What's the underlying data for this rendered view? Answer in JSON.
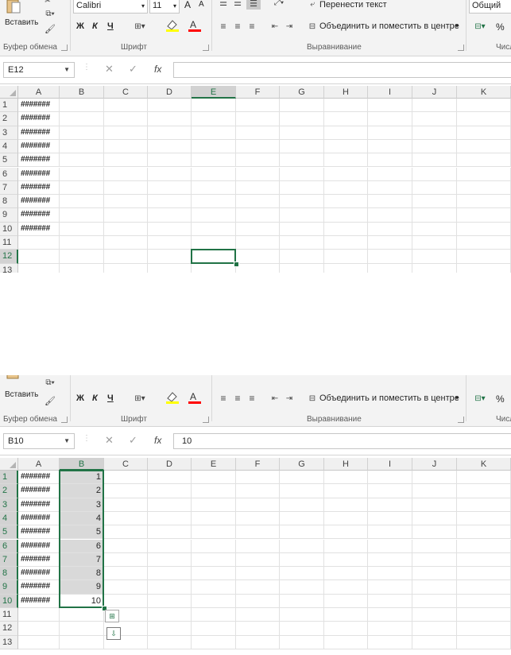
{
  "ribbon": {
    "font_name": "Calibri",
    "font_size": "11",
    "grow_font": "A",
    "shrink_font": "A",
    "bold": "Ж",
    "italic": "К",
    "underline": "Ч",
    "font_color_letter": "A",
    "paste_label": "Вставить",
    "wrap_text": "Перенести текст",
    "merge_center": "Объединить и поместить в центре",
    "number_format": "Общий",
    "percent": "%",
    "group_clipboard": "Буфер обмена",
    "group_font": "Шрифт",
    "group_alignment": "Выравнивание",
    "group_number": "Числ"
  },
  "colors": {
    "accent": "#217346",
    "highlight_yellow": "#ffff00",
    "font_red": "#ff0000",
    "selection_gray": "#d9d9d9"
  },
  "columns": [
    "A",
    "B",
    "C",
    "D",
    "E",
    "F",
    "G",
    "H",
    "I",
    "J",
    "K"
  ],
  "panel1": {
    "name_box": "E12",
    "formula": "",
    "rows": [
      "1",
      "2",
      "3",
      "4",
      "5",
      "6",
      "7",
      "8",
      "9",
      "10",
      "11",
      "12",
      "13"
    ],
    "colA": [
      "#######",
      "#######",
      "#######",
      "#######",
      "#######",
      "#######",
      "#######",
      "#######",
      "#######",
      "#######",
      "",
      "",
      ""
    ]
  },
  "panel2": {
    "name_box": "B10",
    "formula": "10",
    "rows": [
      "1",
      "2",
      "3",
      "4",
      "5",
      "6",
      "7",
      "8",
      "9",
      "10",
      "11",
      "12",
      "13"
    ],
    "colA": [
      "#######",
      "#######",
      "#######",
      "#######",
      "#######",
      "#######",
      "#######",
      "#######",
      "#######",
      "#######",
      "",
      "",
      ""
    ],
    "colB": [
      "1",
      "2",
      "3",
      "4",
      "5",
      "6",
      "7",
      "8",
      "9",
      "10",
      "",
      "",
      ""
    ]
  },
  "icons": {
    "fx": "fx",
    "cancel": "✕",
    "confirm": "✓"
  }
}
